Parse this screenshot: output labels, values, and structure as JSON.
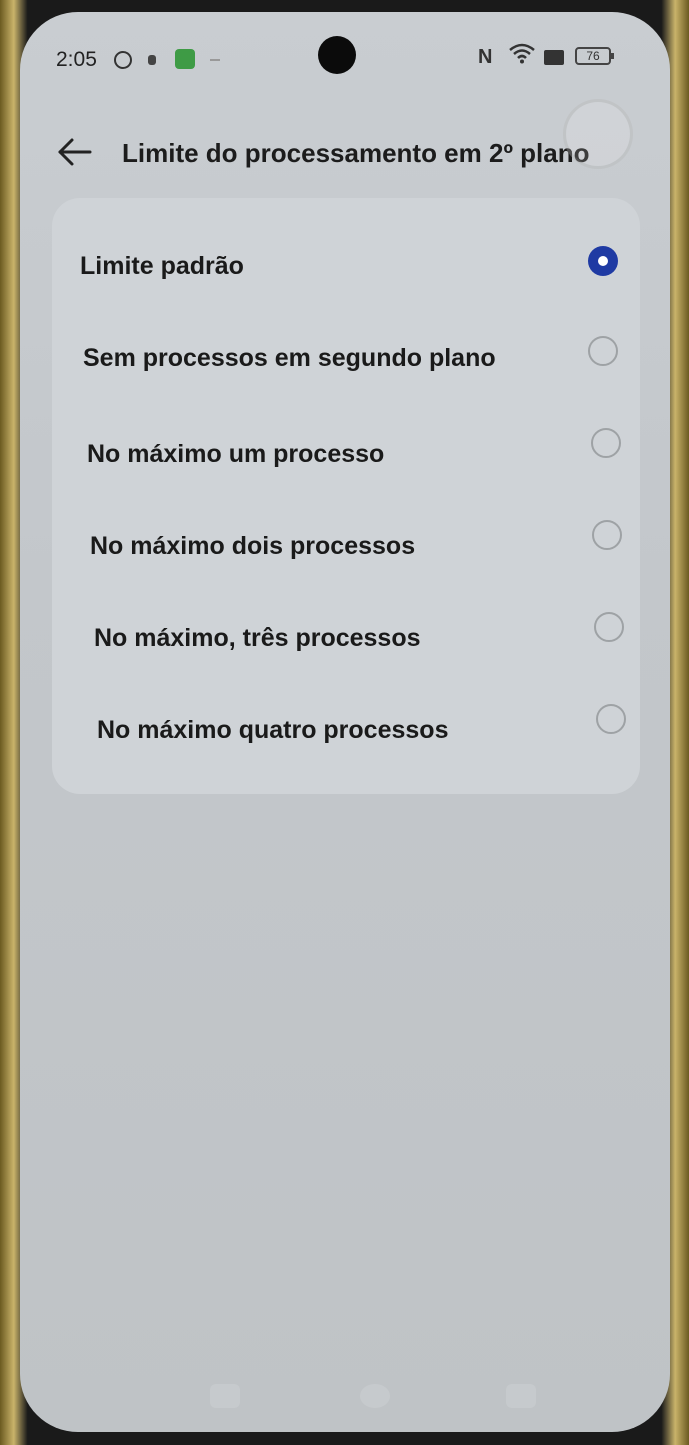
{
  "status_bar": {
    "time": "2:05",
    "battery": "76"
  },
  "header": {
    "title": "Limite do processamento em 2º plano"
  },
  "options": [
    {
      "label": "Limite padrão",
      "selected": true
    },
    {
      "label": "Sem processos em segundo plano",
      "selected": false
    },
    {
      "label": "No máximo um processo",
      "selected": false
    },
    {
      "label": "No máximo dois processos",
      "selected": false
    },
    {
      "label": "No máximo, três processos",
      "selected": false
    },
    {
      "label": "No máximo quatro processos",
      "selected": false
    }
  ],
  "colors": {
    "accent": "#1f3aa3",
    "background": "#c7cbcf",
    "card": "#cfd3d7"
  },
  "icons": {
    "back": "arrow-left-icon",
    "wifi": "wifi-icon",
    "nfc": "nfc-icon",
    "battery": "battery-icon"
  }
}
